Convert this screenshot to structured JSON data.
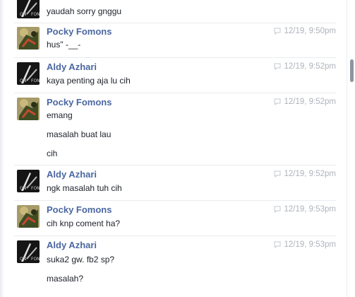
{
  "messages": [
    {
      "sender": "",
      "time": "",
      "lines": [
        "yaudah sorry gnggu"
      ],
      "avatar": "aldy"
    },
    {
      "sender": "Pocky Fomons",
      "time": "12/19, 9:50pm",
      "lines": [
        "hus\" -__-"
      ],
      "avatar": "pocky"
    },
    {
      "sender": "Aldy Azhari",
      "time": "12/19, 9:52pm",
      "lines": [
        "kaya penting aja lu cih"
      ],
      "avatar": "aldy"
    },
    {
      "sender": "Pocky Fomons",
      "time": "12/19, 9:52pm",
      "lines": [
        "emang",
        "masalah buat lau",
        "cih"
      ],
      "avatar": "pocky"
    },
    {
      "sender": "Aldy Azhari",
      "time": "12/19, 9:52pm",
      "lines": [
        "ngk masalah tuh cih"
      ],
      "avatar": "aldy"
    },
    {
      "sender": "Pocky Fomons",
      "time": "12/19, 9:53pm",
      "lines": [
        "cih knp coment ha?"
      ],
      "avatar": "pocky"
    },
    {
      "sender": "Aldy Azhari",
      "time": "12/19, 9:53pm",
      "lines": [
        "suka2 gw. fb2 sp?",
        "masalah?"
      ],
      "avatar": "aldy"
    }
  ],
  "colors": {
    "name": "#4b67a1",
    "meta": "#aeb3bb",
    "text": "#1d2129"
  },
  "icons": {
    "reply": "speech-bubble-icon"
  }
}
